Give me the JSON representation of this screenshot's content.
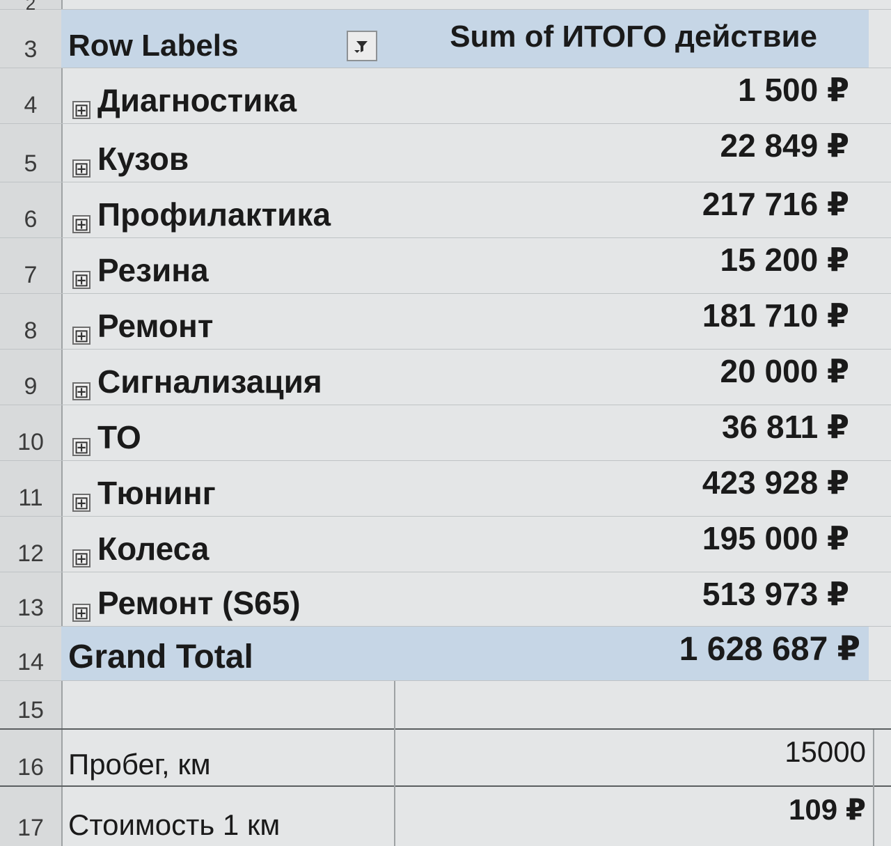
{
  "row_numbers": [
    "2",
    "3",
    "4",
    "5",
    "6",
    "7",
    "8",
    "9",
    "10",
    "11",
    "12",
    "13",
    "14",
    "15",
    "16",
    "17"
  ],
  "pivot": {
    "header_label": "Row Labels",
    "header_value": "Sum of ИТОГО действие",
    "filter_icon": "filter-dropdown-icon",
    "rows": [
      {
        "label": "Диагностика",
        "value": "1 500 ₽"
      },
      {
        "label": "Кузов",
        "value": "22 849 ₽"
      },
      {
        "label": "Профилактика",
        "value": "217 716 ₽"
      },
      {
        "label": "Резина",
        "value": "15 200 ₽"
      },
      {
        "label": "Ремонт",
        "value": "181 710 ₽"
      },
      {
        "label": "Сигнализация",
        "value": "20 000 ₽"
      },
      {
        "label": "ТО",
        "value": "36 811 ₽"
      },
      {
        "label": "Тюнинг",
        "value": "423 928 ₽"
      },
      {
        "label": "Колеса",
        "value": "195 000 ₽"
      },
      {
        "label": "Ремонт (S65)",
        "value": "513 973 ₽"
      }
    ],
    "grand_total_label": "Grand Total",
    "grand_total_value": "1 628 687 ₽",
    "expand_symbol": "⊞"
  },
  "summary": {
    "mileage_label": "Пробег, км",
    "mileage_value": "15000",
    "cost_per_km_label": "Стоимость 1 км",
    "cost_per_km_value": "109 ₽"
  },
  "colors": {
    "header_band": "#c6d6e6",
    "sheet_background": "#e4e6e7",
    "row_header_background": "#d8dadb"
  }
}
